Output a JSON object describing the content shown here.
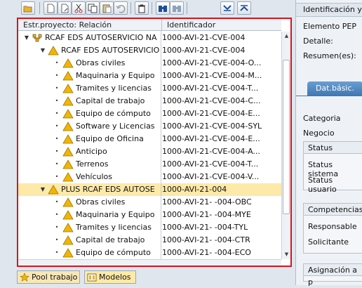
{
  "toolbar": {
    "buttons": [
      "open-folder-icon",
      "new-document-icon",
      "cut-icon",
      "copy-icon",
      "paste-icon",
      "undo-icon",
      "delete-icon",
      "find-icon",
      "find-next-icon",
      "expand-icon",
      "collapse-icon"
    ]
  },
  "tree": {
    "columns": [
      "Estr.proyecto: Relación",
      "Identificador"
    ],
    "rows": [
      {
        "level": 0,
        "expander": "▼",
        "icon": "project",
        "label": "RCAF EDS AUTOSERVICIO NA",
        "id": "1000-AVI-21-CVE-004",
        "selected": false
      },
      {
        "level": 1,
        "expander": "▼",
        "icon": "wbs",
        "label": "RCAF EDS AUTOSERVICIO",
        "id": "1000-AVI-21-CVE-004",
        "selected": false
      },
      {
        "level": 2,
        "expander": "•",
        "icon": "wbs",
        "label": "Obras civiles",
        "id": "1000-AVI-21-CVE-004-O...",
        "selected": false
      },
      {
        "level": 2,
        "expander": "•",
        "icon": "wbs",
        "label": "Maquinaria y Equipo",
        "id": "1000-AVI-21-CVE-004-M...",
        "selected": false
      },
      {
        "level": 2,
        "expander": "•",
        "icon": "wbs",
        "label": "Tramites y licencias",
        "id": "1000-AVI-21-CVE-004-T...",
        "selected": false
      },
      {
        "level": 2,
        "expander": "•",
        "icon": "wbs",
        "label": "Capital de trabajo",
        "id": "1000-AVI-21-CVE-004-C...",
        "selected": false
      },
      {
        "level": 2,
        "expander": "•",
        "icon": "wbs",
        "label": "Equipo de cómputo",
        "id": "1000-AVI-21-CVE-004-E...",
        "selected": false
      },
      {
        "level": 2,
        "expander": "•",
        "icon": "wbs",
        "label": "Software y Licencias",
        "id": "1000-AVI-21-CVE-004-SYL",
        "selected": false
      },
      {
        "level": 2,
        "expander": "•",
        "icon": "wbs",
        "label": "Equipo de Oficina",
        "id": "1000-AVI-21-CVE-004-E...",
        "selected": false
      },
      {
        "level": 2,
        "expander": "•",
        "icon": "wbs",
        "label": "Anticipo",
        "id": "1000-AVI-21-CVE-004-A...",
        "selected": false
      },
      {
        "level": 2,
        "expander": "•",
        "icon": "wbs",
        "label": "Terrenos",
        "id": "1000-AVI-21-CVE-004-T...",
        "selected": false
      },
      {
        "level": 2,
        "expander": "•",
        "icon": "wbs",
        "label": "Vehículos",
        "id": "1000-AVI-21-CVE-004-V...",
        "selected": false
      },
      {
        "level": 1,
        "expander": "▼",
        "icon": "wbs",
        "label": "PLUS RCAF EDS AUTOSE",
        "id": "1000-AVI-21-004",
        "selected": true
      },
      {
        "level": 2,
        "expander": "•",
        "icon": "wbs",
        "label": "Obras civiles",
        "id": "1000-AVI-21-   -004-OBC",
        "selected": false
      },
      {
        "level": 2,
        "expander": "•",
        "icon": "wbs",
        "label": "Maquinaria y Equipo",
        "id": "1000-AVI-21-   -004-MYE",
        "selected": false
      },
      {
        "level": 2,
        "expander": "•",
        "icon": "wbs",
        "label": "Tramites y licencias",
        "id": "1000-AVI-21-   -004-TYL",
        "selected": false
      },
      {
        "level": 2,
        "expander": "•",
        "icon": "wbs",
        "label": "Capital de trabajo",
        "id": "1000-AVI-21-   -004-CTR",
        "selected": false
      },
      {
        "level": 2,
        "expander": "•",
        "icon": "wbs",
        "label": "Equipo de cómputo",
        "id": "1000-AVI-21-   -004-ECO",
        "selected": false
      }
    ]
  },
  "bottom_tabs": [
    {
      "label": "Pool trabajo",
      "icon": "star-icon"
    },
    {
      "label": "Modelos",
      "icon": "model-icon"
    }
  ],
  "right_panel": {
    "header": "Identificación y",
    "elemento_pep": "Elemento PEP",
    "detalle": "Detalle:",
    "resumen": "Resumen(es):",
    "tab": "Dat.básic.",
    "categoria": "Categoria",
    "negocio": "Negocio",
    "status_group": "Status",
    "status_sistema": "Status sistema",
    "status_usuario": "Status usuario",
    "competencias_group": "Competencias",
    "responsable": "Responsable",
    "solicitante": "Solicitante",
    "asignacion": "Asignación a p"
  },
  "colors": {
    "frame_highlight": "#d9141c",
    "selected_row": "#fde9a8",
    "wbs_triangle": "#f2b600",
    "tab_active": "#3f78b4"
  }
}
